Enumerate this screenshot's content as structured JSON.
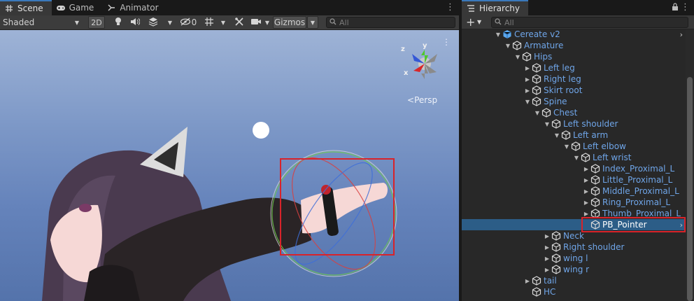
{
  "scene_tabs": [
    {
      "label": "Scene",
      "icon": "hash-icon"
    },
    {
      "label": "Game",
      "icon": "gamepad-icon"
    },
    {
      "label": "Animator",
      "icon": "animator-icon"
    }
  ],
  "hierarchy_tab": {
    "label": "Hierarchy",
    "icon": "list-icon"
  },
  "toolbar": {
    "shading_mode": "Shaded",
    "view_2d": "2D",
    "hidden_count": "0",
    "gizmos": "Gizmos",
    "search_placeholder": "All"
  },
  "viewport": {
    "projection": "Persp",
    "axes": {
      "x": "x",
      "y": "y",
      "z": "z"
    }
  },
  "hierarchy": {
    "search_placeholder": "All",
    "items": [
      {
        "label": "Cereate v2",
        "depth": 0,
        "expanded": true,
        "prefab": true,
        "more": true
      },
      {
        "label": "Armature",
        "depth": 1,
        "expanded": true
      },
      {
        "label": "Hips",
        "depth": 2,
        "expanded": true
      },
      {
        "label": "Left leg",
        "depth": 3,
        "expanded": false
      },
      {
        "label": "Right leg",
        "depth": 3,
        "expanded": false
      },
      {
        "label": "Skirt root",
        "depth": 3,
        "expanded": false
      },
      {
        "label": "Spine",
        "depth": 3,
        "expanded": true
      },
      {
        "label": "Chest",
        "depth": 4,
        "expanded": true
      },
      {
        "label": "Left shoulder",
        "depth": 5,
        "expanded": true
      },
      {
        "label": "Left arm",
        "depth": 6,
        "expanded": true
      },
      {
        "label": "Left elbow",
        "depth": 7,
        "expanded": true
      },
      {
        "label": "Left wrist",
        "depth": 8,
        "expanded": true
      },
      {
        "label": "Index_Proximal_L",
        "depth": 9,
        "expanded": false
      },
      {
        "label": "Little_Proximal_L",
        "depth": 9,
        "expanded": false
      },
      {
        "label": "Middle_Proximal_L",
        "depth": 9,
        "expanded": false
      },
      {
        "label": "Ring_Proximal_L",
        "depth": 9,
        "expanded": false
      },
      {
        "label": "Thumb_Proximal_L",
        "depth": 9,
        "expanded": false
      },
      {
        "label": "PB_Pointer",
        "depth": 9,
        "expanded": null,
        "selected": true,
        "more": true
      },
      {
        "label": "Neck",
        "depth": 5,
        "expanded": false
      },
      {
        "label": "Right shoulder",
        "depth": 5,
        "expanded": false
      },
      {
        "label": "wing l",
        "depth": 5,
        "expanded": false
      },
      {
        "label": "wing r",
        "depth": 5,
        "expanded": false
      },
      {
        "label": "tail",
        "depth": 3,
        "expanded": false
      },
      {
        "label": "HC",
        "depth": 3,
        "expanded": null
      }
    ]
  },
  "colors": {
    "accent": "#3a79bb",
    "selection": "#2c5d87",
    "highlight": "#d8232a",
    "tree_text": "#6fa5e8"
  }
}
